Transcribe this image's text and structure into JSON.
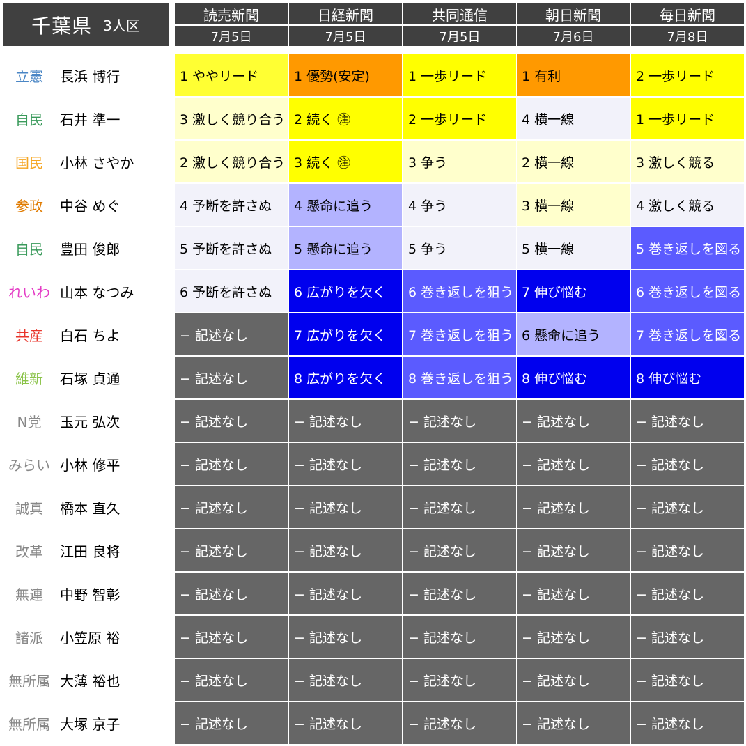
{
  "title": {
    "main": "千葉県",
    "sub": "3人区"
  },
  "media": [
    {
      "name": "読売新聞",
      "date": "7月5日"
    },
    {
      "name": "日経新聞",
      "date": "7月5日"
    },
    {
      "name": "共同通信",
      "date": "7月5日"
    },
    {
      "name": "朝日新聞",
      "date": "7月6日"
    },
    {
      "name": "毎日新聞",
      "date": "7月8日"
    }
  ],
  "rows": [
    {
      "party": "立憲",
      "party_color": "#4a86c5",
      "name": "長浜 博行",
      "cells": [
        {
          "text": "1 ややリード",
          "bg": "#ffff33",
          "fg": "#000000"
        },
        {
          "text": "1 優勢(安定)",
          "bg": "#ff9900",
          "fg": "#000000"
        },
        {
          "text": "1 一歩リード",
          "bg": "#ffff00",
          "fg": "#000000"
        },
        {
          "text": "1 有利",
          "bg": "#ff9900",
          "fg": "#000000"
        },
        {
          "text": "2 一歩リード",
          "bg": "#ffff00",
          "fg": "#000000"
        }
      ]
    },
    {
      "party": "自民",
      "party_color": "#3a9a5b",
      "name": "石井 準一",
      "cells": [
        {
          "text": "3 激しく競り合う",
          "bg": "#ffffcc",
          "fg": "#000000"
        },
        {
          "text": "2 続く ㊟",
          "bg": "#ffff00",
          "fg": "#000000"
        },
        {
          "text": "2 一歩リード",
          "bg": "#ffff00",
          "fg": "#000000"
        },
        {
          "text": "4 横一線",
          "bg": "#f2f2fa",
          "fg": "#000000"
        },
        {
          "text": "1 一歩リード",
          "bg": "#ffff00",
          "fg": "#000000"
        }
      ]
    },
    {
      "party": "国民",
      "party_color": "#f5a623",
      "name": "小林 さやか",
      "cells": [
        {
          "text": "2 激しく競り合う",
          "bg": "#ffffcc",
          "fg": "#000000"
        },
        {
          "text": "3 続く ㊟",
          "bg": "#ffff00",
          "fg": "#000000"
        },
        {
          "text": "3 争う",
          "bg": "#ffffcc",
          "fg": "#000000"
        },
        {
          "text": "2 横一線",
          "bg": "#ffffcc",
          "fg": "#000000"
        },
        {
          "text": "3 激しく競る",
          "bg": "#ffffcc",
          "fg": "#000000"
        }
      ]
    },
    {
      "party": "参政",
      "party_color": "#e07b00",
      "name": "中谷 めぐ",
      "cells": [
        {
          "text": "4 予断を許さぬ",
          "bg": "#f2f2fa",
          "fg": "#000000"
        },
        {
          "text": "4 懸命に追う",
          "bg": "#b3b3ff",
          "fg": "#000000"
        },
        {
          "text": "4 争う",
          "bg": "#f2f2fa",
          "fg": "#000000"
        },
        {
          "text": "3 横一線",
          "bg": "#ffffcc",
          "fg": "#000000"
        },
        {
          "text": "4 激しく競る",
          "bg": "#f2f2fa",
          "fg": "#000000"
        }
      ]
    },
    {
      "party": "自民",
      "party_color": "#3a9a5b",
      "name": "豊田 俊郎",
      "cells": [
        {
          "text": "5 予断を許さぬ",
          "bg": "#f2f2fa",
          "fg": "#000000"
        },
        {
          "text": "5 懸命に追う",
          "bg": "#b3b3ff",
          "fg": "#000000"
        },
        {
          "text": "5 争う",
          "bg": "#f2f2fa",
          "fg": "#000000"
        },
        {
          "text": "5 横一線",
          "bg": "#f2f2fa",
          "fg": "#000000"
        },
        {
          "text": "5 巻き返しを図る",
          "bg": "#5b5bff",
          "fg": "#ffffff"
        }
      ]
    },
    {
      "party": "れいわ",
      "party_color": "#e43cc5",
      "name": "山本 なつみ",
      "cells": [
        {
          "text": "6 予断を許さぬ",
          "bg": "#f2f2fa",
          "fg": "#000000"
        },
        {
          "text": "6 広がりを欠く",
          "bg": "#0000ee",
          "fg": "#ffffff"
        },
        {
          "text": "6 巻き返しを狙う",
          "bg": "#5b5bff",
          "fg": "#ffffff"
        },
        {
          "text": "7 伸び悩む",
          "bg": "#0000ee",
          "fg": "#ffffff"
        },
        {
          "text": "6 巻き返しを図る",
          "bg": "#5b5bff",
          "fg": "#ffffff"
        }
      ]
    },
    {
      "party": "共産",
      "party_color": "#e8352b",
      "name": "白石 ちよ",
      "cells": [
        {
          "text": "− 記述なし",
          "bg": "#666666",
          "fg": "#ffffff"
        },
        {
          "text": "7 広がりを欠く",
          "bg": "#0000ee",
          "fg": "#ffffff"
        },
        {
          "text": "7 巻き返しを狙う",
          "bg": "#5b5bff",
          "fg": "#ffffff"
        },
        {
          "text": "6 懸命に追う",
          "bg": "#b3b3ff",
          "fg": "#000000"
        },
        {
          "text": "7 巻き返しを図る",
          "bg": "#5b5bff",
          "fg": "#ffffff"
        }
      ]
    },
    {
      "party": "維新",
      "party_color": "#8bc34a",
      "name": "石塚 貞通",
      "cells": [
        {
          "text": "− 記述なし",
          "bg": "#666666",
          "fg": "#ffffff"
        },
        {
          "text": "8 広がりを欠く",
          "bg": "#0000ee",
          "fg": "#ffffff"
        },
        {
          "text": "8 巻き返しを狙う",
          "bg": "#5b5bff",
          "fg": "#ffffff"
        },
        {
          "text": "8 伸び悩む",
          "bg": "#0000ee",
          "fg": "#ffffff"
        },
        {
          "text": "8 伸び悩む",
          "bg": "#0000ee",
          "fg": "#ffffff"
        }
      ]
    },
    {
      "party": "N党",
      "party_color": "#888888",
      "name": "玉元 弘次",
      "cells": [
        {
          "text": "− 記述なし",
          "bg": "#666666",
          "fg": "#ffffff"
        },
        {
          "text": "− 記述なし",
          "bg": "#666666",
          "fg": "#ffffff"
        },
        {
          "text": "− 記述なし",
          "bg": "#666666",
          "fg": "#ffffff"
        },
        {
          "text": "− 記述なし",
          "bg": "#666666",
          "fg": "#ffffff"
        },
        {
          "text": "− 記述なし",
          "bg": "#666666",
          "fg": "#ffffff"
        }
      ]
    },
    {
      "party": "みらい",
      "party_color": "#888888",
      "name": "小林 修平",
      "cells": [
        {
          "text": "− 記述なし",
          "bg": "#666666",
          "fg": "#ffffff"
        },
        {
          "text": "− 記述なし",
          "bg": "#666666",
          "fg": "#ffffff"
        },
        {
          "text": "− 記述なし",
          "bg": "#666666",
          "fg": "#ffffff"
        },
        {
          "text": "− 記述なし",
          "bg": "#666666",
          "fg": "#ffffff"
        },
        {
          "text": "− 記述なし",
          "bg": "#666666",
          "fg": "#ffffff"
        }
      ]
    },
    {
      "party": "誠真",
      "party_color": "#888888",
      "name": "橋本 直久",
      "cells": [
        {
          "text": "− 記述なし",
          "bg": "#666666",
          "fg": "#ffffff"
        },
        {
          "text": "− 記述なし",
          "bg": "#666666",
          "fg": "#ffffff"
        },
        {
          "text": "− 記述なし",
          "bg": "#666666",
          "fg": "#ffffff"
        },
        {
          "text": "− 記述なし",
          "bg": "#666666",
          "fg": "#ffffff"
        },
        {
          "text": "− 記述なし",
          "bg": "#666666",
          "fg": "#ffffff"
        }
      ]
    },
    {
      "party": "改革",
      "party_color": "#888888",
      "name": "江田 良将",
      "cells": [
        {
          "text": "− 記述なし",
          "bg": "#666666",
          "fg": "#ffffff"
        },
        {
          "text": "− 記述なし",
          "bg": "#666666",
          "fg": "#ffffff"
        },
        {
          "text": "− 記述なし",
          "bg": "#666666",
          "fg": "#ffffff"
        },
        {
          "text": "− 記述なし",
          "bg": "#666666",
          "fg": "#ffffff"
        },
        {
          "text": "− 記述なし",
          "bg": "#666666",
          "fg": "#ffffff"
        }
      ]
    },
    {
      "party": "無連",
      "party_color": "#888888",
      "name": "中野 智彰",
      "cells": [
        {
          "text": "− 記述なし",
          "bg": "#666666",
          "fg": "#ffffff"
        },
        {
          "text": "− 記述なし",
          "bg": "#666666",
          "fg": "#ffffff"
        },
        {
          "text": "− 記述なし",
          "bg": "#666666",
          "fg": "#ffffff"
        },
        {
          "text": "− 記述なし",
          "bg": "#666666",
          "fg": "#ffffff"
        },
        {
          "text": "− 記述なし",
          "bg": "#666666",
          "fg": "#ffffff"
        }
      ]
    },
    {
      "party": "諸派",
      "party_color": "#888888",
      "name": "小笠原 裕",
      "cells": [
        {
          "text": "− 記述なし",
          "bg": "#666666",
          "fg": "#ffffff"
        },
        {
          "text": "− 記述なし",
          "bg": "#666666",
          "fg": "#ffffff"
        },
        {
          "text": "− 記述なし",
          "bg": "#666666",
          "fg": "#ffffff"
        },
        {
          "text": "− 記述なし",
          "bg": "#666666",
          "fg": "#ffffff"
        },
        {
          "text": "− 記述なし",
          "bg": "#666666",
          "fg": "#ffffff"
        }
      ]
    },
    {
      "party": "無所属",
      "party_color": "#888888",
      "name": "大薄 裕也",
      "cells": [
        {
          "text": "− 記述なし",
          "bg": "#666666",
          "fg": "#ffffff"
        },
        {
          "text": "− 記述なし",
          "bg": "#666666",
          "fg": "#ffffff"
        },
        {
          "text": "− 記述なし",
          "bg": "#666666",
          "fg": "#ffffff"
        },
        {
          "text": "− 記述なし",
          "bg": "#666666",
          "fg": "#ffffff"
        },
        {
          "text": "− 記述なし",
          "bg": "#666666",
          "fg": "#ffffff"
        }
      ]
    },
    {
      "party": "無所属",
      "party_color": "#888888",
      "name": "大塚 京子",
      "cells": [
        {
          "text": "− 記述なし",
          "bg": "#666666",
          "fg": "#ffffff"
        },
        {
          "text": "− 記述なし",
          "bg": "#666666",
          "fg": "#ffffff"
        },
        {
          "text": "− 記述なし",
          "bg": "#666666",
          "fg": "#ffffff"
        },
        {
          "text": "− 記述なし",
          "bg": "#666666",
          "fg": "#ffffff"
        },
        {
          "text": "− 記述なし",
          "bg": "#666666",
          "fg": "#ffffff"
        }
      ]
    }
  ]
}
